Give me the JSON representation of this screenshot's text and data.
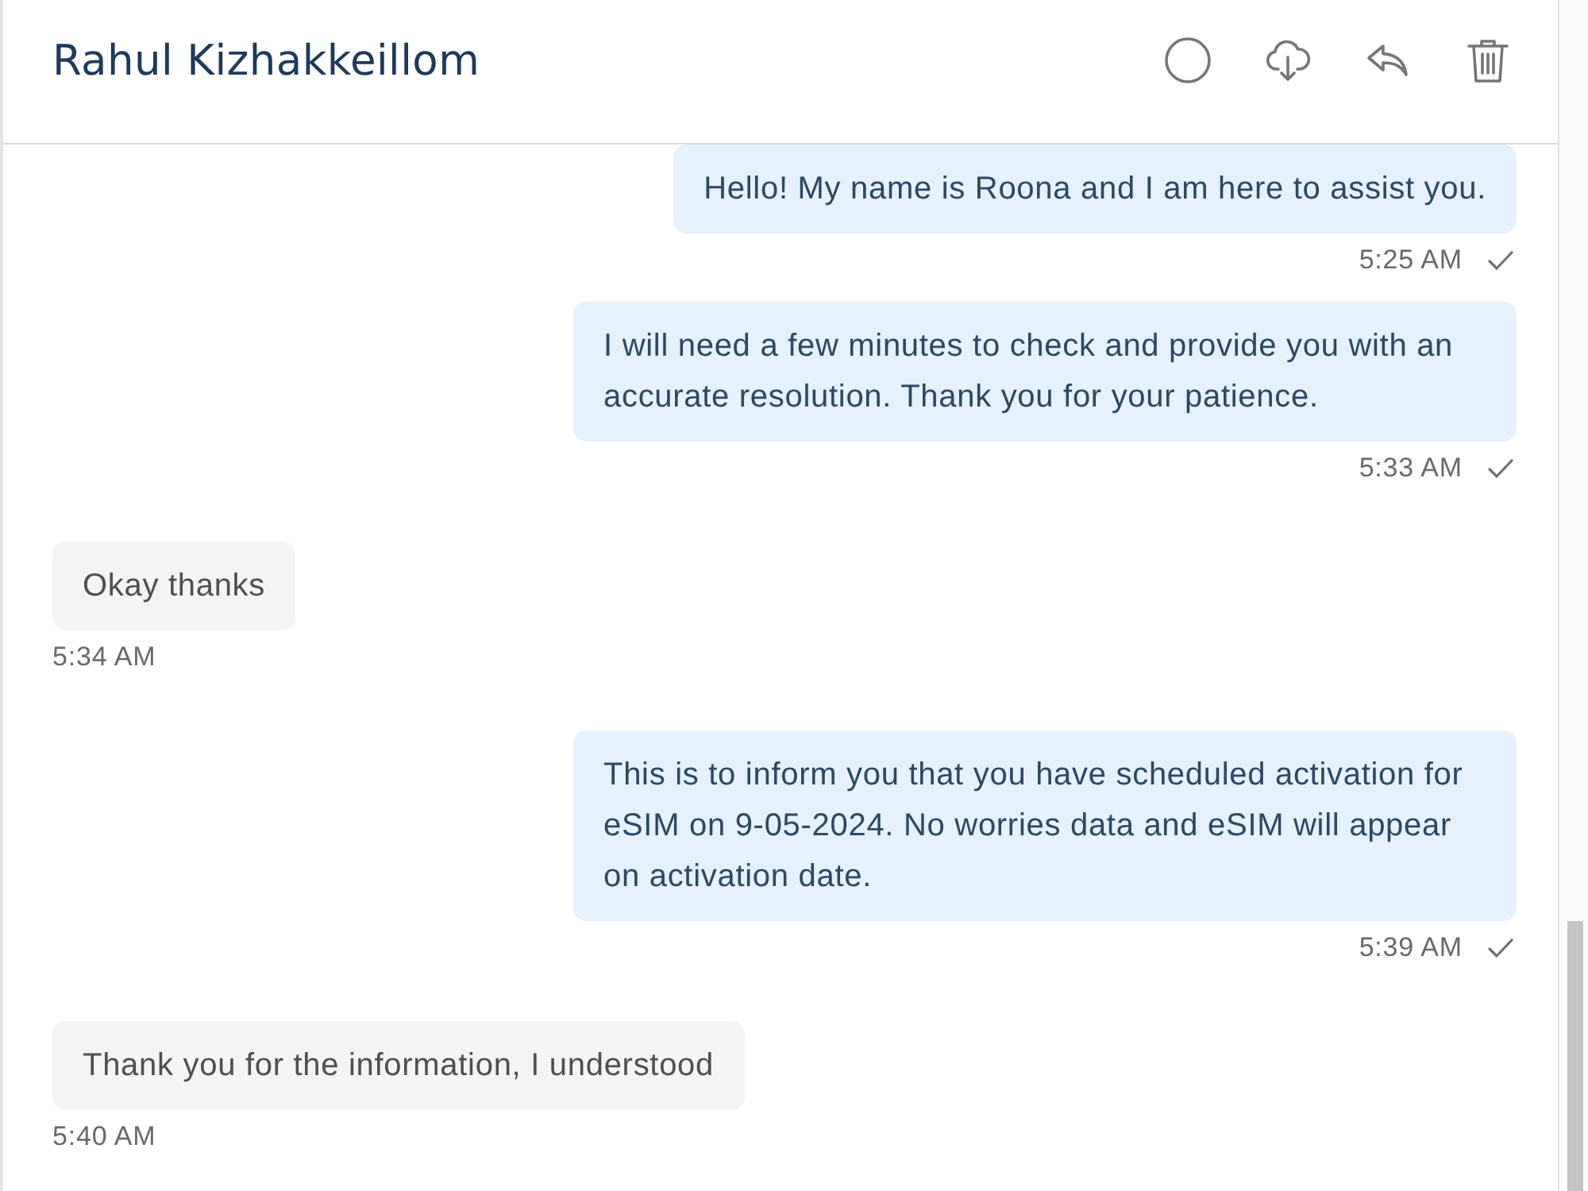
{
  "header": {
    "title": "Rahul Kizhakkeillom"
  },
  "messages": [
    {
      "kind": "outgoing",
      "text": "Hello! My name is Roona and I am here to assist you.",
      "time": "5:25 AM"
    },
    {
      "kind": "outgoing",
      "text": "I will need a few minutes to check and provide you with an accurate resolution. Thank you for your patience.",
      "time": "5:33 AM"
    },
    {
      "kind": "incoming",
      "text": "Okay thanks",
      "time": "5:34 AM"
    },
    {
      "kind": "outgoing",
      "text": "This is to inform you that you have scheduled activation for eSIM on 9-05-2024. No worries data and eSIM will appear on activation date.",
      "time": "5:39 AM"
    },
    {
      "kind": "incoming",
      "text": "Thank you for the information, I understood",
      "time": "5:40 AM"
    }
  ]
}
